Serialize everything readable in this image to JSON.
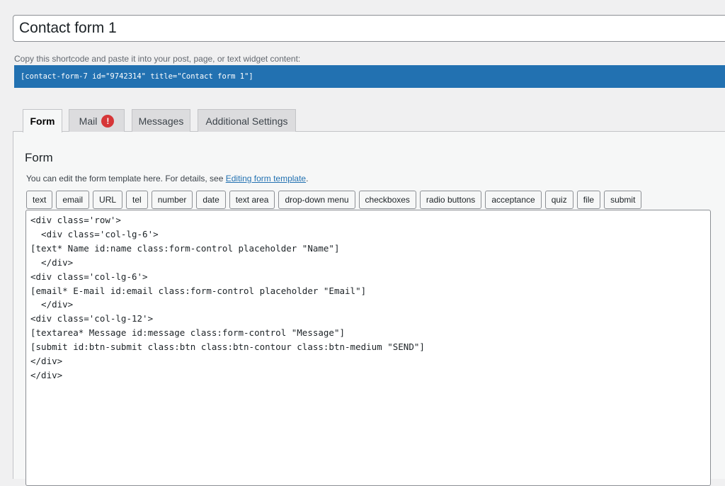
{
  "title_field": {
    "value": "Contact form 1"
  },
  "shortcode": {
    "label": "Copy this shortcode and paste it into your post, page, or text widget content:",
    "value": "[contact-form-7 id=\"9742314\" title=\"Contact form 1\"]"
  },
  "tabs": [
    {
      "label": "Form",
      "active": true
    },
    {
      "label": "Mail",
      "badge": "!"
    },
    {
      "label": "Messages"
    },
    {
      "label": "Additional Settings"
    }
  ],
  "panel": {
    "heading": "Form",
    "desc_prefix": "You can edit the form template here. For details, see ",
    "desc_link": "Editing form template",
    "desc_suffix": "."
  },
  "tag_buttons": [
    "text",
    "email",
    "URL",
    "tel",
    "number",
    "date",
    "text area",
    "drop-down menu",
    "checkboxes",
    "radio buttons",
    "acceptance",
    "quiz",
    "file",
    "submit"
  ],
  "template_code": "<div class='row'>\n  <div class='col-lg-6'>\n[text* Name id:name class:form-control placeholder \"Name\"]\n  </div>\n<div class='col-lg-6'>\n[email* E-mail id:email class:form-control placeholder \"Email\"]\n  </div>\n<div class='col-lg-12'>\n[textarea* Message id:message class:form-control \"Message\"]\n[submit id:btn-submit class:btn class:btn-contour class:btn-medium \"SEND\"]\n</div>\n</div>",
  "colors": {
    "accent": "#2271b1",
    "badge": "#d63638",
    "background": "#f0f0f1"
  }
}
